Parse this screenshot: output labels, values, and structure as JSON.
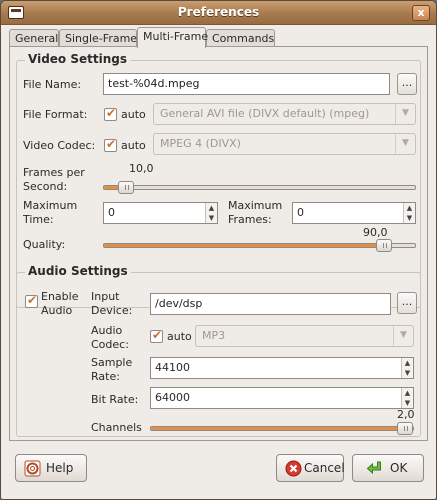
{
  "window": {
    "title": "Preferences",
    "close_glyph": "x"
  },
  "tabs": [
    {
      "label": "General",
      "active": false
    },
    {
      "label": "Single-Frame",
      "active": false
    },
    {
      "label": "Multi-Frame",
      "active": true
    },
    {
      "label": "Commands",
      "active": false
    }
  ],
  "video": {
    "title": "Video Settings",
    "file_name_label": "File Name:",
    "file_name_value": "test-%04d.mpeg",
    "browse_label": "...",
    "file_format_label": "File Format:",
    "file_format_auto_label": "auto",
    "file_format_auto_checked": true,
    "file_format_value": "General AVI file (DIVX default) (mpeg)",
    "video_codec_label": "Video Codec:",
    "video_codec_auto_label": "auto",
    "video_codec_auto_checked": true,
    "video_codec_value": "MPEG 4 (DIVX)",
    "fps_label_line1": "Frames per",
    "fps_label_line2": "Second:",
    "fps_value": "10,0",
    "fps_fraction": 0.07,
    "max_time_label_line1": "Maximum",
    "max_time_label_line2": "Time:",
    "max_time_value": "0",
    "max_frames_label_line1": "Maximum",
    "max_frames_label_line2": "Frames:",
    "max_frames_value": "0",
    "quality_label": "Quality:",
    "quality_value": "90,0",
    "quality_fraction": 0.9
  },
  "audio": {
    "title": "Audio Settings",
    "enable_label_line1": "Enable",
    "enable_label_line2": "Audio",
    "enable_checked": true,
    "input_device_label_line1": "Input",
    "input_device_label_line2": "Device:",
    "input_device_value": "/dev/dsp",
    "browse_label": "...",
    "codec_label_line1": "Audio",
    "codec_label_line2": "Codec:",
    "codec_auto_label": "auto",
    "codec_auto_checked": true,
    "codec_value": "MP3",
    "sample_rate_label_line1": "Sample",
    "sample_rate_label_line2": "Rate:",
    "sample_rate_value": "44100",
    "bit_rate_label": "Bit Rate:",
    "bit_rate_value": "64000",
    "channels_label": "Channels",
    "channels_value": "2,0",
    "channels_fraction": 1.0
  },
  "buttons": {
    "help_label": "Help",
    "cancel_label": "Cancel",
    "ok_label": "OK"
  },
  "colors": {
    "accent": "#e48f45",
    "titlebar": "#a77a4e",
    "check": "#c9722e"
  }
}
